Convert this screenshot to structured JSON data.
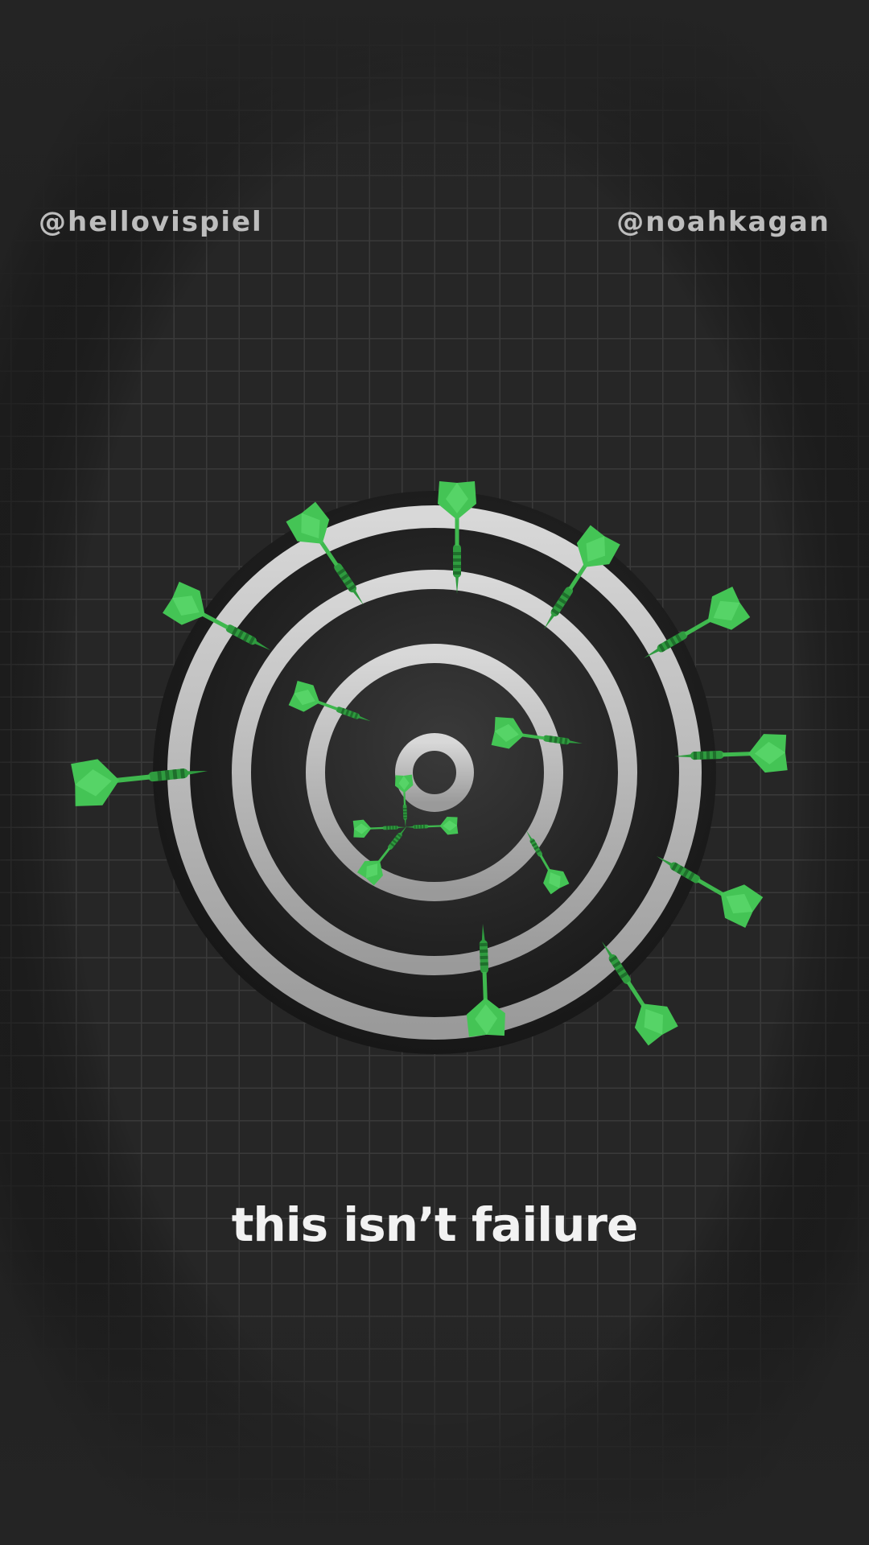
{
  "header": {
    "left_handle": "@hellovispiel",
    "right_handle": "@noahkagan"
  },
  "caption": {
    "text": "this isn’t failure"
  },
  "colors": {
    "background": "#242424",
    "grid_line": "#3a3a3a",
    "board_dark": "#1c1c1c",
    "board_ring": "#cfcfcf",
    "dart_green": "#3fbf4f",
    "dart_dark_green": "#2b8f3a",
    "caption_text": "#f2f2f2",
    "handle_text": "#bdbdbd"
  },
  "icons": {
    "board": "target-icon",
    "dart": "dart-icon"
  }
}
